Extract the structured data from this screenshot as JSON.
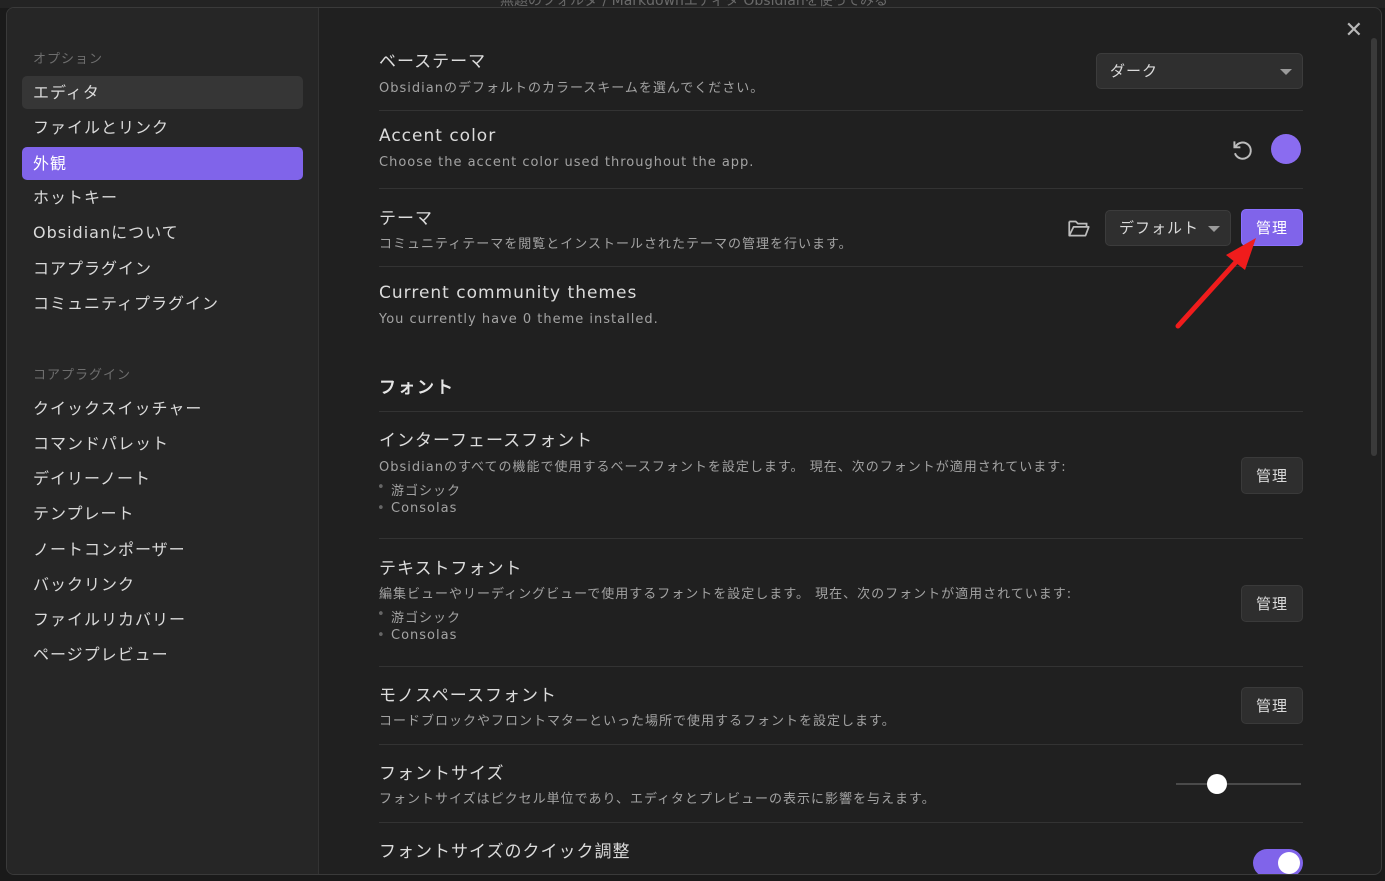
{
  "background": {
    "title_text": "無題のフォルダ / Markdownエディタ Obsidianを使ってみる"
  },
  "colors": {
    "accent": "#8064ea",
    "background": "#202020",
    "sidebar": "#262626"
  },
  "sidebar": {
    "group_options": "オプション",
    "options": [
      {
        "label": "エディタ"
      },
      {
        "label": "ファイルとリンク"
      },
      {
        "label": "外観"
      },
      {
        "label": "ホットキー"
      },
      {
        "label": "Obsidianについて"
      },
      {
        "label": "コアプラグイン"
      },
      {
        "label": "コミュニティプラグイン"
      }
    ],
    "group_core": "コアプラグイン",
    "core": [
      {
        "label": "クイックスイッチャー"
      },
      {
        "label": "コマンドパレット"
      },
      {
        "label": "デイリーノート"
      },
      {
        "label": "テンプレート"
      },
      {
        "label": "ノートコンポーザー"
      },
      {
        "label": "バックリンク"
      },
      {
        "label": "ファイルリカバリー"
      },
      {
        "label": "ページプレビュー"
      }
    ]
  },
  "close_icon": "close-icon",
  "settings": {
    "base_theme": {
      "name": "ベーステーマ",
      "desc": "Obsidianのデフォルトのカラースキームを選んでください。",
      "value": "ダーク"
    },
    "accent": {
      "name": "Accent color",
      "desc": "Choose the accent color used throughout the app.",
      "color": "#8a6cf0"
    },
    "theme": {
      "name": "テーマ",
      "desc": "コミュニティテーマを閲覧とインストールされたテーマの管理を行います。",
      "value": "デフォルト",
      "manage": "管理"
    },
    "community": {
      "name": "Current community themes",
      "desc": "You currently have 0 theme installed."
    },
    "font_section": "フォント",
    "interface_font": {
      "name": "インターフェースフォント",
      "desc": "Obsidianのすべての機能で使用するベースフォントを設定します。 現在、次のフォントが適用されています:",
      "fonts": [
        "游ゴシック",
        "Consolas"
      ],
      "manage": "管理"
    },
    "text_font": {
      "name": "テキストフォント",
      "desc": "編集ビューやリーディングビューで使用するフォントを設定します。 現在、次のフォントが適用されています:",
      "fonts": [
        "游ゴシック",
        "Consolas"
      ],
      "manage": "管理"
    },
    "mono_font": {
      "name": "モノスペースフォント",
      "desc": "コードブロックやフロントマターといった場所で使用するフォントを設定します。",
      "manage": "管理"
    },
    "font_size": {
      "name": "フォントサイズ",
      "desc": "フォントサイズはピクセル単位であり、エディタとプレビューの表示に影響を与えます。",
      "level": 0.33
    },
    "quick_font": {
      "name": "フォントサイズのクイック調整",
      "enabled": true
    }
  }
}
